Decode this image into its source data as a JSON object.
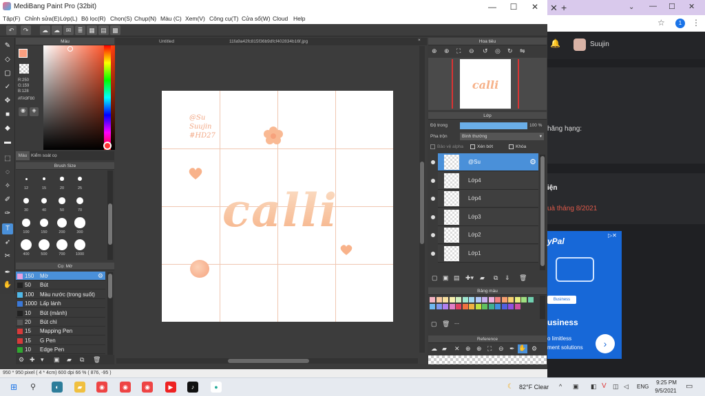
{
  "window": {
    "title": "MediBang Paint Pro (32bit)",
    "minimize": "—",
    "maximize": "☐",
    "close": "✕"
  },
  "menu": [
    "Tập(F)",
    "Chỉnh sửa(E)",
    "Lớp(L)",
    "Bộ lọc(R)",
    "Chọn(S)",
    "Chụp(N)",
    "Màu (C)",
    "Xem(V)",
    "Công cụ(T)",
    "Cửa sổ(W)",
    "Cloud",
    "Help"
  ],
  "color_panel": {
    "title": "Màu",
    "rgb": [
      "R:250",
      "G:159",
      "B:128"
    ],
    "hex": "#FA9F80",
    "tab_color": "Màu",
    "tab_mode": "Kiểm soát cọ"
  },
  "brush_size": {
    "title": "Brush Size",
    "sizes": [
      "12",
      "15",
      "20",
      "25",
      "30",
      "40",
      "50",
      "70",
      "100",
      "150",
      "200",
      "300",
      "400",
      "500",
      "700",
      "1000"
    ]
  },
  "brush_list": {
    "title": "Cọ: Mờ",
    "items": [
      {
        "size": "150",
        "name": "Mờ",
        "color": "#e6a0e0"
      },
      {
        "size": "50",
        "name": "Bút",
        "color": "#222222"
      },
      {
        "size": "100",
        "name": "Màu nước (trong suốt)",
        "color": "#4fb8e8"
      },
      {
        "size": "1000",
        "name": "Lấp lánh",
        "color": "#3a78d8"
      },
      {
        "size": "10",
        "name": "Bút (mảnh)",
        "color": "#222222"
      },
      {
        "size": "20",
        "name": "Bút chì",
        "color": "#555555"
      },
      {
        "size": "15",
        "name": "Mapping Pen",
        "color": "#d83a3a"
      },
      {
        "size": "15",
        "name": "G Pen",
        "color": "#d83a3a"
      },
      {
        "size": "10",
        "name": "Edge Pen",
        "color": "#2fa82f"
      }
    ]
  },
  "canvas": {
    "tabs": [
      "Untitled",
      "11fa9a42fc815f36b9dfcf402834b16f.jpg"
    ],
    "text_watermark": [
      "@Su",
      "Suujin",
      "#HD27"
    ],
    "text_main": "calli"
  },
  "navigator": {
    "title": "Hoa tiêu",
    "thumb_text": "calli"
  },
  "layer_panel": {
    "title": "Lớp",
    "opacity_label": "Độ trong",
    "opacity_value": "100 %",
    "opacity": 1.0,
    "blend_label": "Pha trộn",
    "blend_value": "Bình thường",
    "protect_alpha": "Bảo vệ alpha",
    "clipping": "Xén bớt",
    "lock": "Khóa",
    "layers": [
      "@Su",
      "Lớp4",
      "Lớp4",
      "Lớp3",
      "Lớp2",
      "Lớp1"
    ]
  },
  "palette": {
    "title": "Bảng màu",
    "colors": [
      "#f4b4c4",
      "#f8c8a0",
      "#f8e0a0",
      "#f8f0b0",
      "#d0f0c0",
      "#a0e8d0",
      "#a0d8f0",
      "#b0c8f8",
      "#c8b0f0",
      "#f0b0e0",
      "#f08080",
      "#f8a070",
      "#f8d070",
      "#e8f080",
      "#a0e080",
      "#70d0b0",
      "#70b8f0",
      "#8098f0",
      "#b080f0",
      "#e080c8",
      "#e04060",
      "#f07040",
      "#f0b040",
      "#c0e040",
      "#60c060",
      "#40b090",
      "#4090e0",
      "#5060e0",
      "#9050e0",
      "#d050a0"
    ],
    "dash": "---"
  },
  "reference": {
    "title": "Reference"
  },
  "status": {
    "text": "950 * 950 pixel  ( 4 * 4cm)  600 dpi  66 %  ( 876, -95 )"
  },
  "browser": {
    "user": "Suujin",
    "frag1": "hăng hạng:",
    "frag2": "iện",
    "frag3": "uà tháng 8/2021",
    "ad_brand": "yPal",
    "ad_chip": "Business",
    "ad_title": "usiness",
    "ad_l1": "o limitless",
    "ad_l2": "ment solutions"
  },
  "taskbar": {
    "weather": "82°F  Clear",
    "lang": "ENG",
    "time": "9:25 PM",
    "date": "9/5/2021"
  }
}
